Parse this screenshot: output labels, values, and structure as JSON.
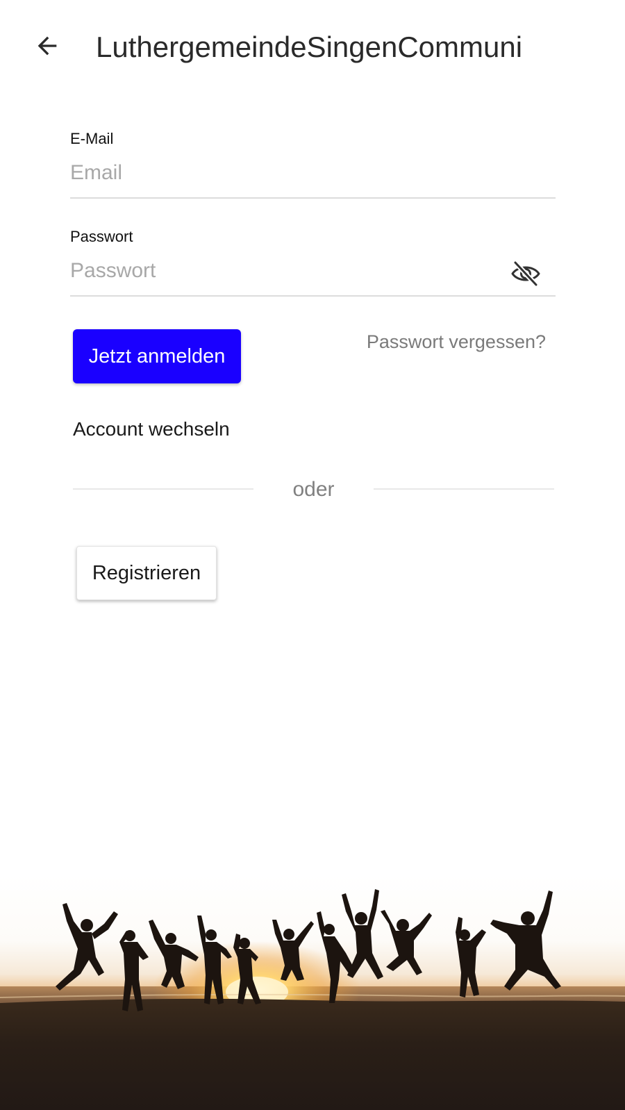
{
  "header": {
    "back_icon": "arrow-left-icon",
    "title": "LuthergemeindeSingenCommuni"
  },
  "form": {
    "email": {
      "label": "E-Mail",
      "placeholder": "Email",
      "value": ""
    },
    "password": {
      "label": "Passwort",
      "placeholder": "Passwort",
      "value": "",
      "toggle_icon": "eye-off-icon"
    },
    "login_label": "Jetzt anmelden",
    "forgot_label": "Passwort vergessen?",
    "switch_account_label": "Account wechseln",
    "divider_label": "oder",
    "register_label": "Registrieren"
  },
  "hero": {
    "image": "silhouettes-jumping-at-sunset-beach"
  },
  "colors": {
    "primary": "#1a00ff",
    "muted_text": "#7a7a7a",
    "placeholder": "#a8a8a8",
    "divider": "#e8e8e8"
  }
}
